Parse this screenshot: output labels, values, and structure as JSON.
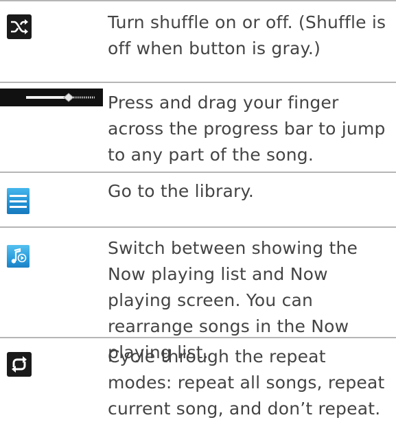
{
  "rows": [
    {
      "icon": "shuffle-icon",
      "text": "Turn shuffle on or off. (Shuffle is off when button is gray.)"
    },
    {
      "icon": "progress-bar-icon",
      "text": "Press and drag your finger across the progress bar to jump to any part of the song."
    },
    {
      "icon": "library-menu-icon",
      "text": "Go to the library."
    },
    {
      "icon": "now-playing-icon",
      "text": "Switch between showing the Now playing list and Now playing screen. You can rearrange songs in the Now playing list."
    },
    {
      "icon": "repeat-icon",
      "text": "Cycle through the repeat modes: repeat all songs, repeat current song, and don’t repeat."
    }
  ],
  "colors": {
    "divider": "#b5b5b5",
    "text": "#444444",
    "icon_dark": "#1a1a1a",
    "icon_blue": "#2596d8"
  }
}
